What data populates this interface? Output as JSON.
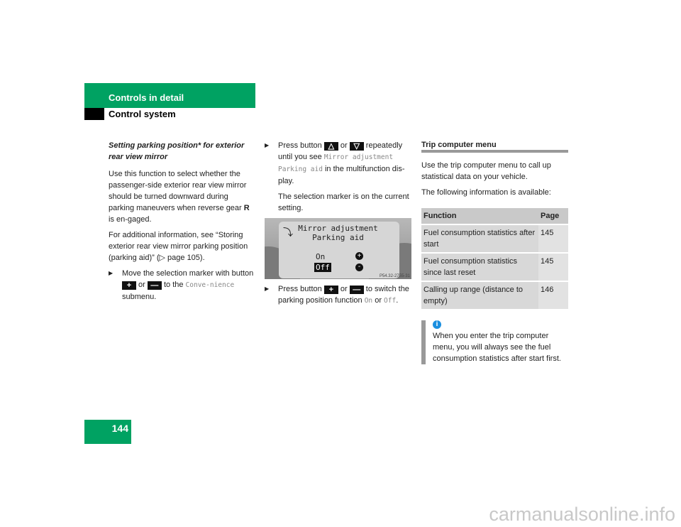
{
  "header": {
    "section": "Controls in detail",
    "subsection": "Control system"
  },
  "page_number": "144",
  "col1": {
    "heading": "Setting parking position* for exterior rear view mirror",
    "p1_a": "Use this function to select whether the passenger-side exterior rear view mirror should be turned downward during parking maneuvers when reverse gear ",
    "p1_gear": "R",
    "p1_b": " is en-gaged.",
    "p2": "For additional information, see “Storing exterior rear view mirror parking position (parking aid)” (▷ page 105).",
    "step_a": "Move the selection marker with button ",
    "plus": "+",
    "or": " or ",
    "minus": "—",
    "step_b": " to the ",
    "step_mono": "Conve-nience",
    "step_c": " submenu."
  },
  "col2": {
    "step1_a": "Press button ",
    "up": "△",
    "or": " or ",
    "down": "▽",
    "step1_b": " repeatedly until you see ",
    "step1_mono": "Mirror adjustment Parking aid",
    "step1_c": " in the multifunction dis-play.",
    "note": "The selection marker is on the current setting.",
    "display": {
      "line1": "Mirror adjustment",
      "line2": "Parking aid",
      "on": "On",
      "off": "Off",
      "ref": "P54.32-2755-31"
    },
    "step2_a": "Press button ",
    "plus": "+",
    "minus": "—",
    "step2_b": " to switch the parking position function ",
    "on": "On",
    "or2": " or ",
    "off": "Off",
    "end": "."
  },
  "col3": {
    "title": "Trip computer menu",
    "p1": "Use the trip computer menu to call up statistical data on your vehicle.",
    "p2": "The following information is available:",
    "table": {
      "headers": [
        "Function",
        "Page"
      ],
      "rows": [
        [
          "Fuel consumption statistics after start",
          "145"
        ],
        [
          "Fuel consumption statistics since last reset",
          "145"
        ],
        [
          "Calling up range (distance to empty)",
          "146"
        ]
      ]
    },
    "info": "When you enter the trip computer menu, you will always see the fuel consumption statistics after start first."
  },
  "watermark": "carmanualsonline.info",
  "colors": {
    "brand": "#00a262",
    "info": "#1a8fe0"
  }
}
